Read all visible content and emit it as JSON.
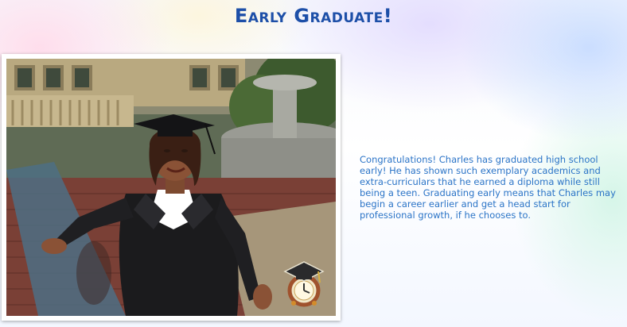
{
  "dialog": {
    "title": "Early Graduate!",
    "description": "Congratulations! Charles has graduated high school early! He has shown such exemplary academics and extra-curriculars that he earned a diploma while still being a teen. Graduating early means that Charles may begin a career earlier and get a head start for professional growth, if he chooses to."
  },
  "icons": {
    "scene": "graduate-in-cap-and-gown-image",
    "badge": "graduation-cap-clock-icon"
  },
  "colors": {
    "title": "#1d4fa8",
    "description": "#2b74c7"
  }
}
